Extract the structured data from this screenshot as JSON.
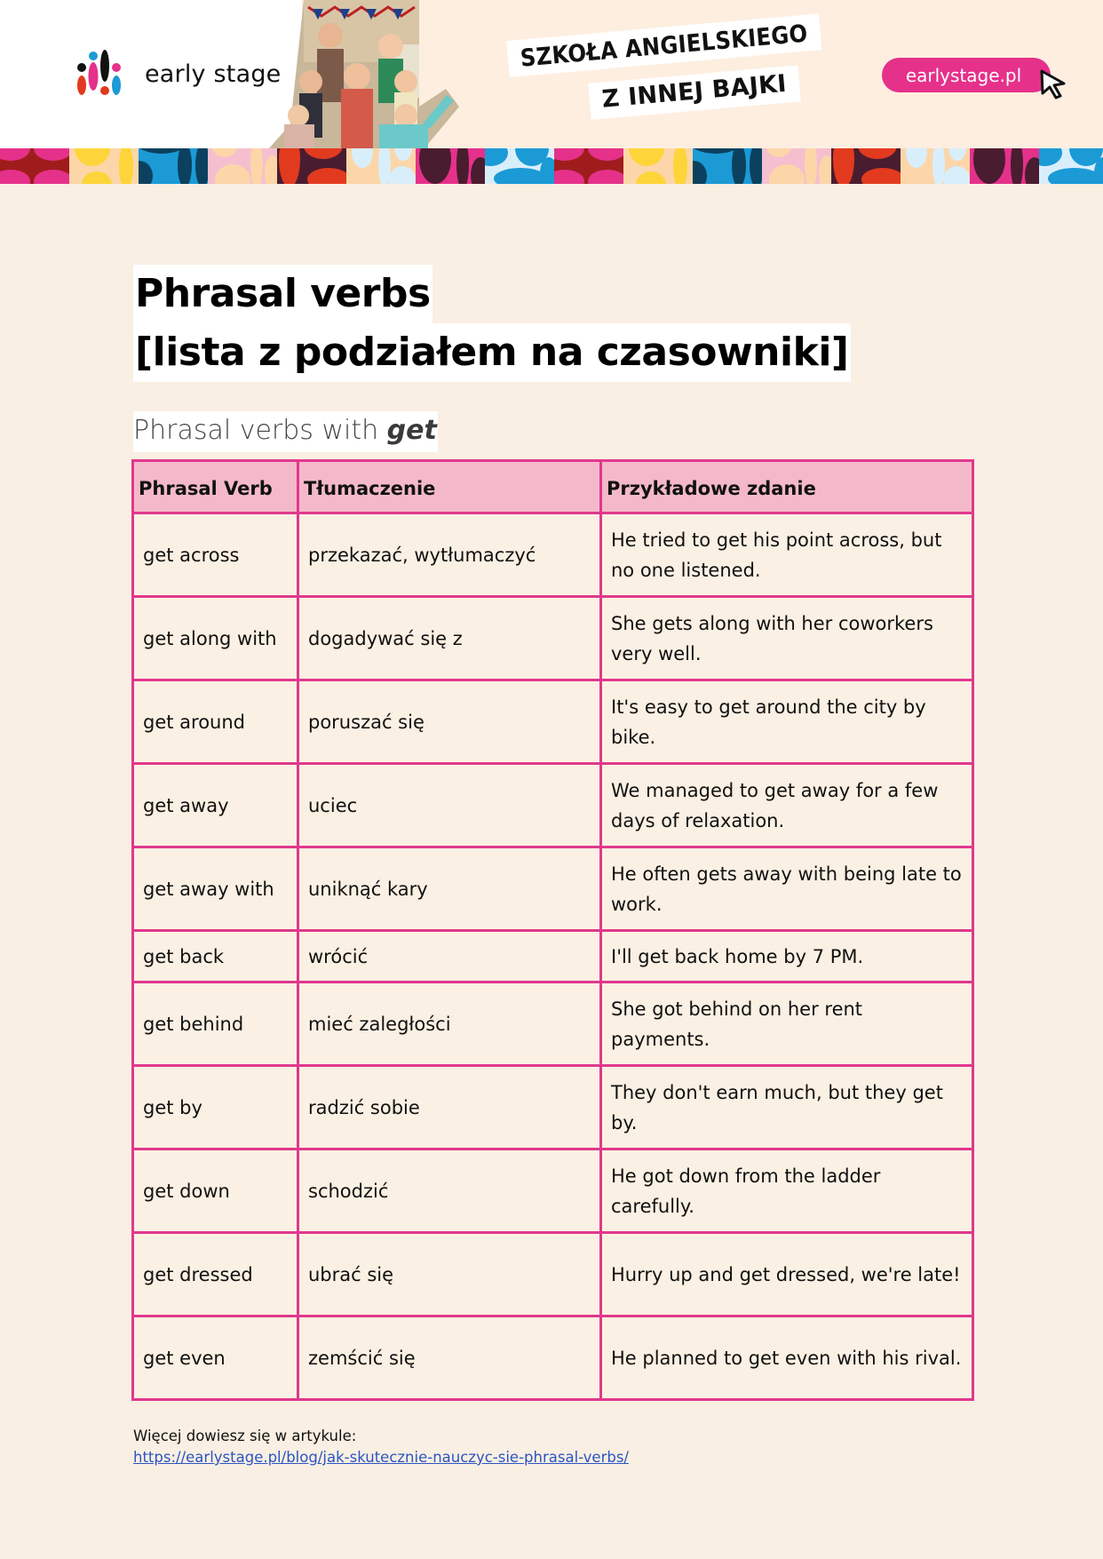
{
  "header": {
    "brand_name": "early stage",
    "slogan_line1": "SZKOŁA ANGIELSKIEGO",
    "slogan_line2": "Z INNEJ BAJKI",
    "site_button": "earlystage.pl",
    "logo_icon": "early-stage-logo-icon",
    "cursor_icon": "mouse-pointer-icon",
    "photo": "group-of-smiling-students-photo",
    "colors": {
      "pink": "#e5318a",
      "red": "#e23a1f",
      "blue": "#1b9ad6",
      "black": "#111111",
      "cream": "#fdeee0"
    }
  },
  "pattern_colors": {
    "tiles": [
      {
        "bg": "#a01c1c",
        "fg": "#e5318a"
      },
      {
        "bg": "#fcd6a8",
        "fg": "#fdd53a"
      },
      {
        "bg": "#1b9ad6",
        "fg": "#0b415e"
      },
      {
        "bg": "#f5bfcf",
        "fg": "#fcd6a8"
      },
      {
        "bg": "#4a1c30",
        "fg": "#e23a1f"
      },
      {
        "bg": "#fcd6a8",
        "fg": "#d9eefb"
      },
      {
        "bg": "#e5318a",
        "fg": "#4a1c30"
      },
      {
        "bg": "#d9eefb",
        "fg": "#1b9ad6"
      }
    ]
  },
  "document": {
    "title_line1": "Phrasal verbs",
    "title_line2": "[lista z podziałem na czasowniki]",
    "subtitle_prefix": "Phrasal verbs with ",
    "subtitle_emphasis": "get",
    "table": {
      "border_color": "#e0388e",
      "header_bg": "#f4b9c9",
      "headers": [
        "Phrasal Verb",
        "Tłumaczenie",
        "Przykładowe zdanie"
      ],
      "rows": [
        {
          "verb": "get across",
          "translation": "przekazać, wytłumaczyć",
          "example": "He tried to get his point across, but no one listened."
        },
        {
          "verb": "get along with",
          "translation": "dogadywać się z",
          "example": "She gets along with her coworkers very well."
        },
        {
          "verb": "get around",
          "translation": "poruszać się",
          "example": "It's easy to get around the city by bike."
        },
        {
          "verb": "get away",
          "translation": "uciec",
          "example": "We managed to get away for a few days of relaxation."
        },
        {
          "verb": "get away with",
          "translation": "uniknąć kary",
          "example": "He often gets away with being late to work."
        },
        {
          "verb": "get back",
          "translation": "wrócić",
          "example": "I'll get back home by 7 PM."
        },
        {
          "verb": "get behind",
          "translation": "mieć zaległości",
          "example": "She got behind on her rent payments."
        },
        {
          "verb": "get by",
          "translation": "radzić sobie",
          "example": "They don't earn much, but they get by."
        },
        {
          "verb": "get down",
          "translation": "schodzić",
          "example": "He got down from the ladder carefully."
        },
        {
          "verb": "get dressed",
          "translation": "ubrać się",
          "example": "Hurry up and get dressed, we're late!"
        },
        {
          "verb": "get even",
          "translation": "zemścić się",
          "example": "He planned to get even with his rival."
        }
      ]
    },
    "footer_note": "Więcej dowiesz się w artykule:",
    "footer_link": "https://earlystage.pl/blog/jak-skutecznie-nauczyc-sie-phrasal-verbs/"
  }
}
